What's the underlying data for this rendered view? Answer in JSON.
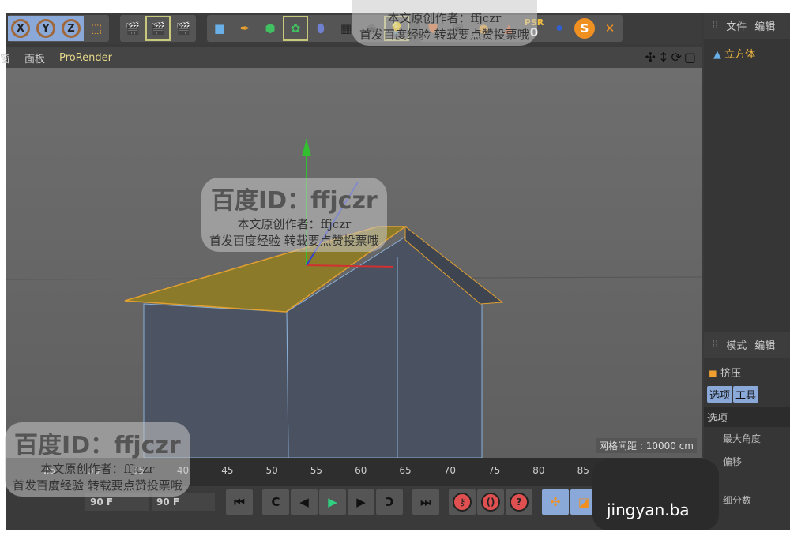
{
  "toolbar": {
    "axes": [
      "X",
      "Y",
      "Z"
    ],
    "psr_label": "PSR",
    "psr_value": "0"
  },
  "menubar": {
    "items": [
      "窗",
      "面板"
    ],
    "active": "ProRender"
  },
  "viewport": {
    "nav_icons": "✣↕⟳▢",
    "grid_spacing": "网格间距 : 10000 cm"
  },
  "object_panel": {
    "tabs": [
      "文件",
      "编辑"
    ],
    "object": "立方体"
  },
  "attr_panel": {
    "tabs": [
      "模式",
      "编辑"
    ],
    "tool": "挤压",
    "buttons": [
      "选项",
      "工具"
    ],
    "section": "选项",
    "fields": [
      "最大角度",
      "偏移",
      "细分数"
    ]
  },
  "timeline": {
    "ticks": [
      "25",
      "30",
      "35",
      "40",
      "45",
      "50",
      "55",
      "60",
      "65",
      "70",
      "75",
      "80",
      "85"
    ]
  },
  "transport": {
    "frame_start": "90 F",
    "frame_end": "90 F"
  },
  "watermarks": {
    "id": "百度ID：ffjczr",
    "author": "本文原创作者：ffjczr",
    "note": "首发百度经验 转载要点赞投票哦",
    "site": "jingyan.ba"
  }
}
